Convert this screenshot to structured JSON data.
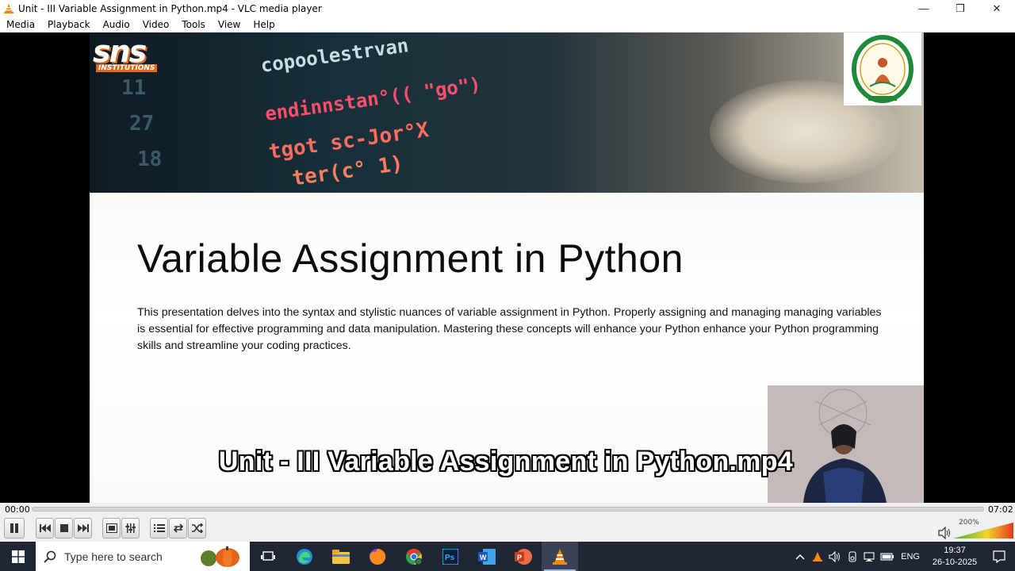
{
  "window": {
    "title": "Unit - III Variable Assignment in Python.mp4 - VLC media player",
    "minimize": "—",
    "restore": "❐",
    "close": "✕"
  },
  "menu": [
    "Media",
    "Playback",
    "Audio",
    "Video",
    "Tools",
    "View",
    "Help"
  ],
  "slide": {
    "logo_letters": "sns",
    "logo_sub": "INSTITUTIONS",
    "title": "Variable Assignment in Python",
    "body": "This presentation delves into the syntax and stylistic nuances of variable assignment in Python. Properly assigning and managing managing variables is essential for effective programming and data manipulation. Mastering these concepts will enhance your Python enhance your Python programming skills and streamline your coding practices.",
    "code_lines": [
      "copoolestrvan",
      "endinnstan°(( \"go\")",
      "tgot sc-Jor°X",
      "ter(c° 1)"
    ]
  },
  "subtitle": "Unit - III Variable Assignment in Python.mp4",
  "player": {
    "time_elapsed": "00:00",
    "time_total": "07:02",
    "progress": 0.0,
    "volume_label": "200%",
    "volume_level": 1.0
  },
  "taskbar": {
    "search_placeholder": "Type here to search",
    "language": "ENG",
    "time": "19:37",
    "date": "26-10-2025"
  },
  "colors": {
    "seek_fill": "#2f7fd6",
    "taskbar": "#202633",
    "logo_orange": "#e06a17"
  }
}
